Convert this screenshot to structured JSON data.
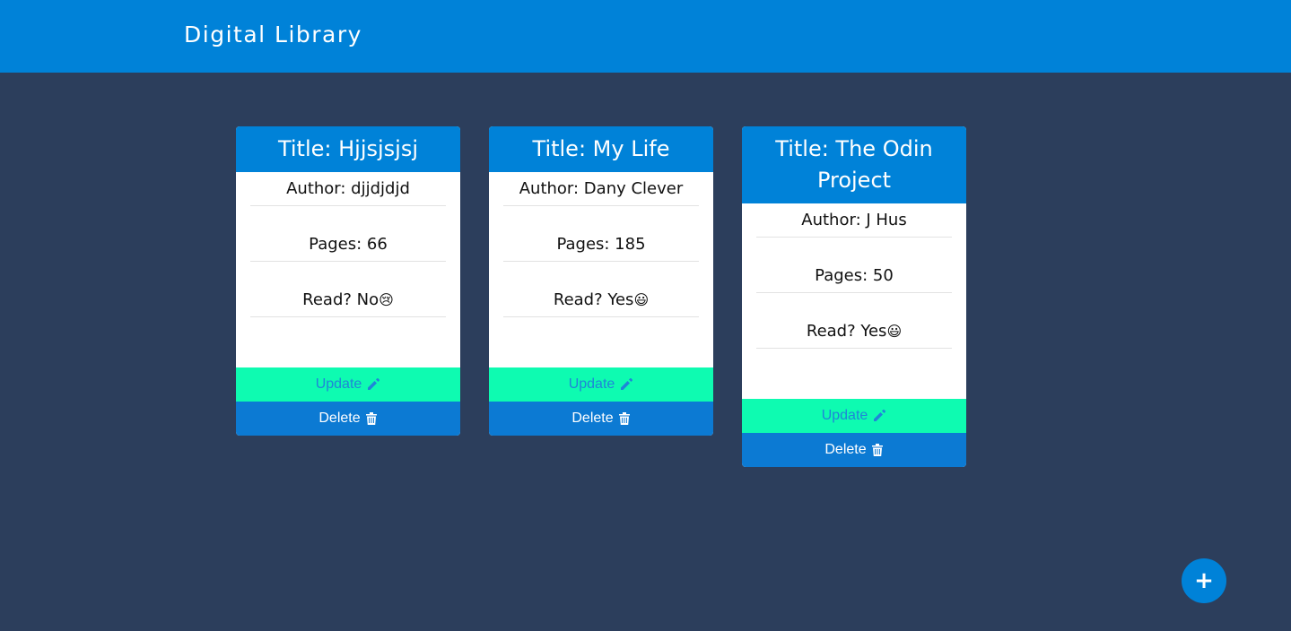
{
  "header": {
    "title": "Digital Library"
  },
  "books": [
    {
      "title": "Title: Hjjsjsjsj",
      "author": "Author: djjdjdjd",
      "pages": "Pages: 66",
      "read": "Read? No",
      "read_emoji": "😢",
      "update_label": "Update",
      "delete_label": "Delete"
    },
    {
      "title": "Title: My Life",
      "author": "Author: Dany Clever",
      "pages": "Pages: 185",
      "read": "Read? Yes",
      "read_emoji": "😃",
      "update_label": "Update",
      "delete_label": "Delete"
    },
    {
      "title": "Title: The Odin Project",
      "author": "Author: J Hus",
      "pages": "Pages: 50",
      "read": "Read? Yes",
      "read_emoji": "😃",
      "update_label": "Update",
      "delete_label": "Delete"
    }
  ],
  "fab": {
    "label": "+"
  },
  "colors": {
    "background": "#2c3e5c",
    "primary": "#0082d8",
    "update_bg": "#0efbb1",
    "delete_bg": "#0c7ad3"
  },
  "icons": {
    "update": "pencil-icon",
    "delete": "trash-icon",
    "fab": "plus-icon"
  }
}
